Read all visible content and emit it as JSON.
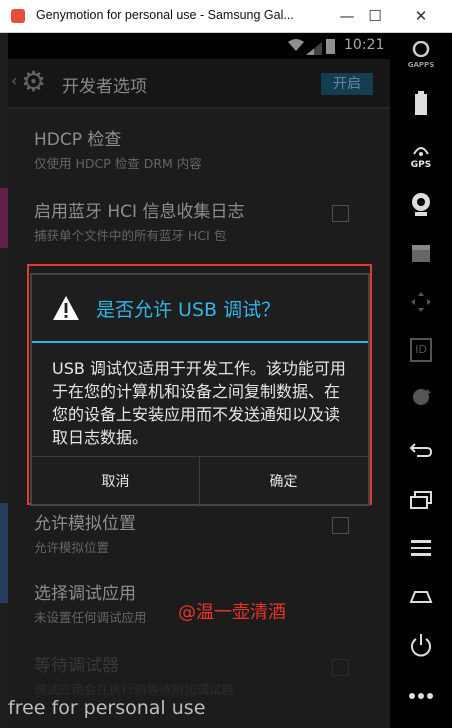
{
  "window": {
    "title": "Genymotion for personal use - Samsung Gal...",
    "minimize": "—",
    "maximize": "☐",
    "close": "✕"
  },
  "statusbar": {
    "time": "10:21"
  },
  "actionbar": {
    "title": "开发者选项",
    "toggle": "开启"
  },
  "settings": {
    "items": [
      {
        "title": "HDCP 检查",
        "subtitle": "仅使用 HDCP 检查 DRM 内容"
      },
      {
        "title": "启用蓝牙 HCI 信息收集日志",
        "subtitle": "捕获单个文件中的所有蓝牙 HCI 包"
      },
      {
        "title": "允许模拟位置",
        "subtitle": "允许模拟位置"
      },
      {
        "title": "选择调试应用",
        "subtitle": "未设置任何调试应用"
      },
      {
        "title": "等待调试器",
        "subtitle": "调试应用会在执行前等待附加调试器"
      }
    ]
  },
  "dialog": {
    "title": "是否允许 USB 调试？",
    "message": "USB 调试仅适用于开发工作。该功能可用于在您的计算机和设备之间复制数据、在您的设备上安装应用而不发送通知以及读取日志数据。",
    "cancel": "取消",
    "ok": "确定"
  },
  "overlay": {
    "watermark": "@温一壶清酒",
    "footer": "free for personal use"
  },
  "toolbar": {
    "gapps_label": "GAPPS",
    "gps_label": "GPS",
    "id_label": "ID"
  }
}
